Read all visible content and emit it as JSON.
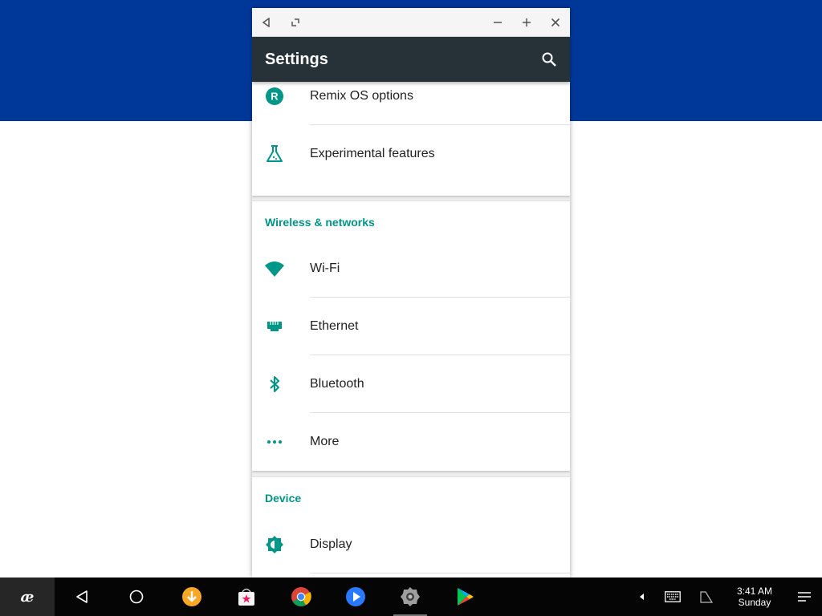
{
  "window": {
    "title_buttons": [
      "back-icon",
      "restore-icon",
      "minimize-icon",
      "maximize-icon",
      "close-icon"
    ]
  },
  "appbar": {
    "title": "Settings",
    "search_icon": "search-icon"
  },
  "sections": [
    {
      "header": "",
      "items": [
        {
          "label": "Remix OS options",
          "icon": "remix-r-icon"
        },
        {
          "label": "Experimental features",
          "icon": "flask-icon"
        }
      ]
    },
    {
      "header": "Wireless & networks",
      "items": [
        {
          "label": "Wi-Fi",
          "icon": "wifi-icon"
        },
        {
          "label": "Ethernet",
          "icon": "ethernet-icon"
        },
        {
          "label": "Bluetooth",
          "icon": "bluetooth-icon"
        },
        {
          "label": "More",
          "icon": "more-horiz-icon"
        }
      ]
    },
    {
      "header": "Device",
      "items": [
        {
          "label": "Display",
          "icon": "brightness-icon"
        }
      ]
    }
  ],
  "taskbar": {
    "start": "remix-logo-icon",
    "nav": [
      "back-triangle-icon",
      "home-circle-icon"
    ],
    "apps": [
      "downloader-app-icon",
      "store-bag-app-icon",
      "chrome-app-icon",
      "video-player-app-icon",
      "settings-gear-app-icon",
      "play-store-app-icon"
    ],
    "tray": [
      "tray-expand-icon",
      "keyboard-icon",
      "signal-icon"
    ],
    "clock_time": "3:41 AM",
    "clock_day": "Sunday",
    "menu": "notification-menu-icon"
  },
  "colors": {
    "accent": "#009688",
    "appbar": "#263238",
    "wallpaper": "#00389a",
    "taskbar": "#050505"
  }
}
